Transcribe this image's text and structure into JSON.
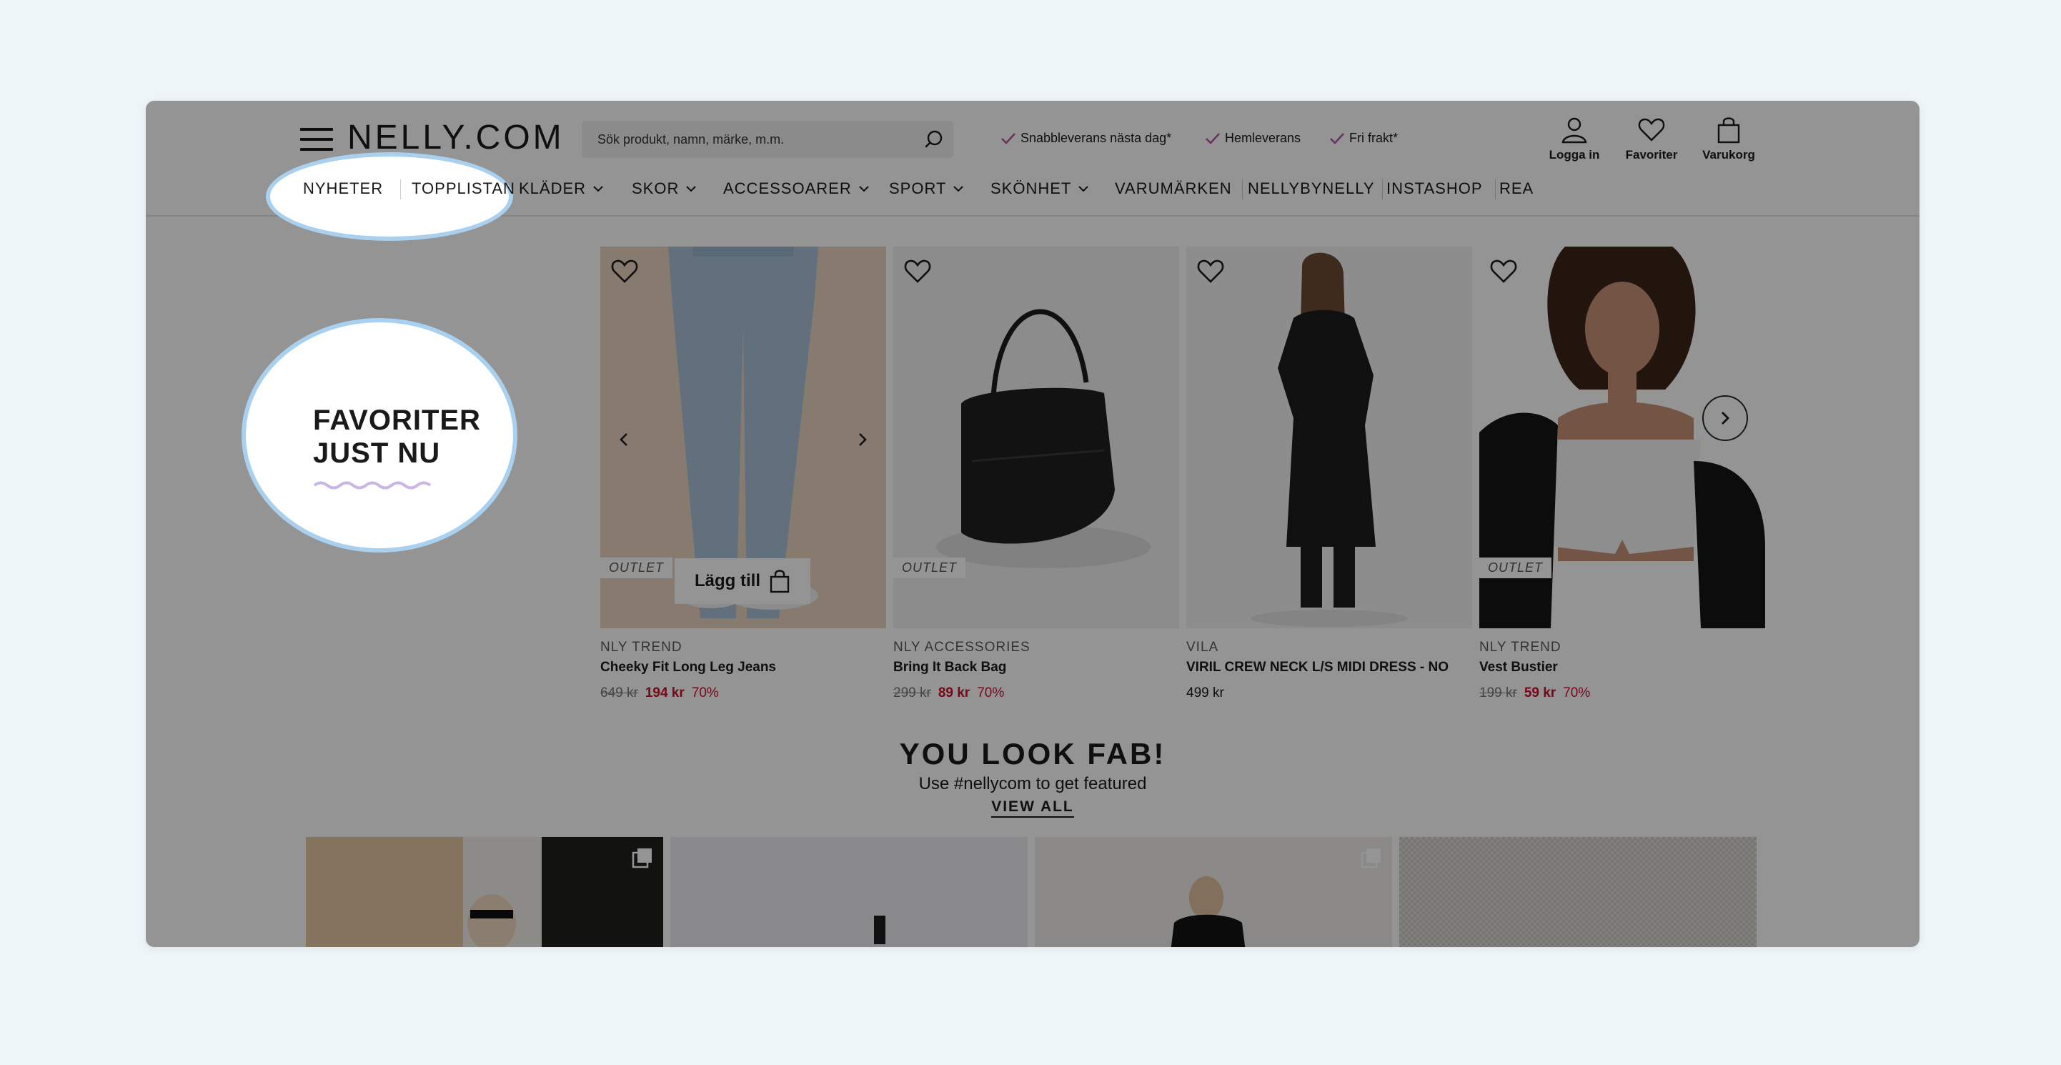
{
  "header": {
    "logo": "NELLY.COM",
    "search_placeholder": "Sök produkt, namn, märke, m.m.",
    "usps": [
      "Snabbleverans nästa dag*",
      "Hemleverans",
      "Fri frakt*"
    ],
    "login_label": "Logga in",
    "favorites_label": "Favoriter",
    "cart_label": "Varukorg"
  },
  "nav": {
    "items": [
      {
        "label": "NYHETER"
      },
      {
        "label": "TOPPLISTAN"
      },
      {
        "label": "KLÄDER"
      },
      {
        "label": "SKOR"
      },
      {
        "label": "ACCESSOARER"
      },
      {
        "label": "SPORT"
      },
      {
        "label": "SKÖNHET"
      },
      {
        "label": "VARUMÄRKEN"
      },
      {
        "label": "NELLYBYNELLY"
      },
      {
        "label": "INSTASHOP"
      },
      {
        "label": "REA"
      }
    ]
  },
  "favorites": {
    "title_line1": "FAVORITER",
    "title_line2": "JUST NU"
  },
  "products": [
    {
      "brand": "NLY TREND",
      "name": "Cheeky Fit Long Leg Jeans",
      "old_price": "649 kr",
      "price": "194 kr",
      "discount": "70%",
      "badge": "OUTLET"
    },
    {
      "brand": "NLY ACCESSORIES",
      "name": "Bring It Back Bag",
      "old_price": "299 kr",
      "price": "89 kr",
      "discount": "70%",
      "badge": "OUTLET"
    },
    {
      "brand": "VILA",
      "name": "VIRIL CREW NECK L/S MIDI DRESS - NO",
      "old_price": "",
      "price": "499 kr",
      "discount": "",
      "badge": ""
    },
    {
      "brand": "NLY TREND",
      "name": "Vest Bustier",
      "old_price": "199 kr",
      "price": "59 kr",
      "discount": "70%",
      "badge": "OUTLET"
    }
  ],
  "add_to_cart_label": "Lägg till",
  "fab": {
    "title": "YOU LOOK FAB!",
    "subtitle": "Use #nellycom to get featured",
    "link": "VIEW ALL"
  },
  "colors": {
    "sale": "#c8102e",
    "highlight_ring": "#a9d0ef",
    "background": "#eef5f9"
  }
}
